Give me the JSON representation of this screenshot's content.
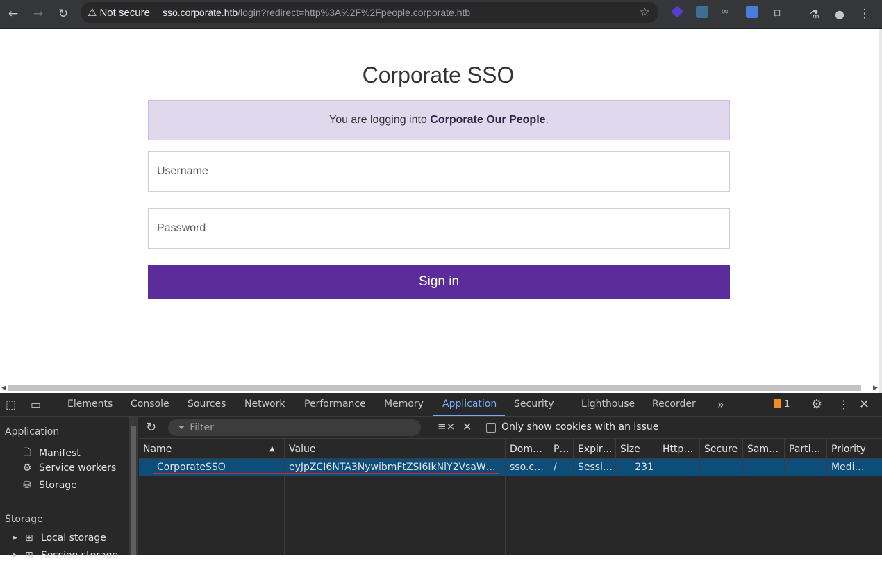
{
  "browser": {
    "security_label": "Not secure",
    "url_host": "sso.corporate.htb",
    "url_path": "/login?redirect=http%3A%2F%2Fpeople.corporate.htb"
  },
  "page": {
    "title": "Corporate SSO",
    "notice_prefix": "You are logging into ",
    "notice_bold": "Corporate Our People",
    "notice_suffix": ".",
    "username_placeholder": "Username",
    "password_placeholder": "Password",
    "signin_label": "Sign in"
  },
  "devtools": {
    "tabs": [
      "Elements",
      "Console",
      "Sources",
      "Network",
      "Performance",
      "Memory",
      "Application",
      "Security",
      "Lighthouse",
      "Recorder"
    ],
    "active_tab": "Application",
    "issues_count": "1",
    "sidebar": {
      "application_header": "Application",
      "application_items": [
        "Manifest",
        "Service workers",
        "Storage"
      ],
      "storage_header": "Storage",
      "storage_items": [
        "Local storage",
        "Session storage"
      ]
    },
    "filter_placeholder": "Filter",
    "only_issues_label": "Only show cookies with an issue",
    "columns": [
      "Name",
      "Value",
      "Dom…",
      "P…",
      "Expir…",
      "Size",
      "Http…",
      "Secure",
      "Sam…",
      "Parti…",
      "Priority"
    ],
    "cookie_row": {
      "name": "CorporateSSO",
      "value": "eyJpZCI6NTA3NywibmFtZSI6IkNlY2VsaWE…",
      "domain": "sso.c…",
      "path": "/",
      "expires": "Sessi…",
      "size": "231",
      "http_only": "",
      "secure": "",
      "same_site": "",
      "partition": "",
      "priority": "Medi…"
    }
  }
}
